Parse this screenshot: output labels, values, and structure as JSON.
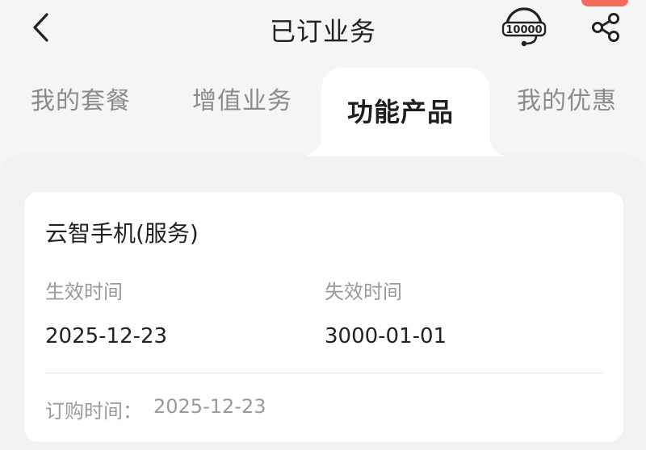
{
  "header": {
    "title": "已订业务",
    "back_icon": "chevron-left-icon",
    "service_icon": "customer-service-10000-icon",
    "service_label": "10000",
    "share_icon": "share-icon"
  },
  "tabs": [
    {
      "label": "我的套餐",
      "active": false
    },
    {
      "label": "增值业务",
      "active": false
    },
    {
      "label": "功能产品",
      "active": true
    },
    {
      "label": "我的优惠",
      "active": false
    }
  ],
  "card": {
    "title": "云智手机(服务)",
    "effective_label": "生效时间",
    "effective_value": "2025-12-23",
    "expire_label": "失效时间",
    "expire_value": "3000-01-01",
    "order_label": "订购时间：",
    "order_value": "2025-12-23"
  },
  "colors": {
    "background": "#f5f5f5",
    "card": "#ffffff",
    "text_primary": "#222222",
    "text_secondary": "#9a9a9a",
    "badge": "#f36b5b"
  }
}
